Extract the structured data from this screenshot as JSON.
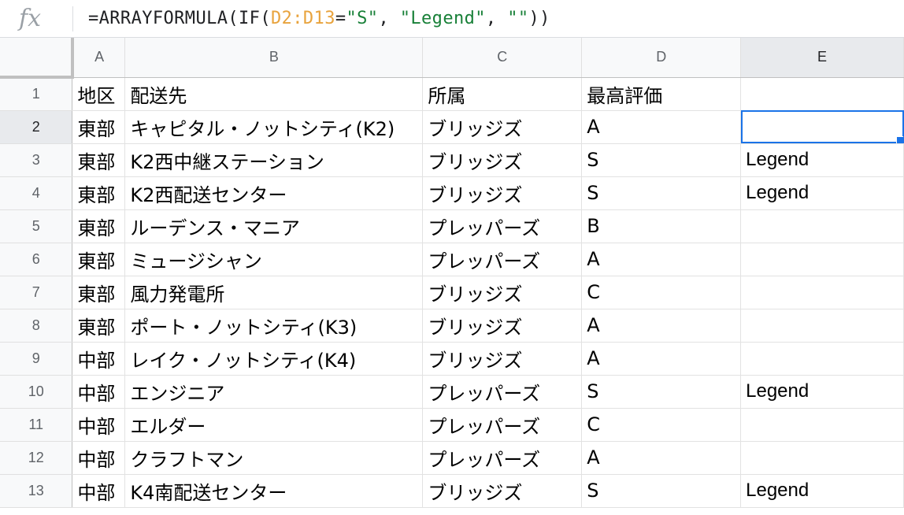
{
  "formula_bar": {
    "icon": "fx",
    "tokens": [
      "=ARRAYFORMULA(IF(",
      "D2:D13",
      "=",
      "\"S\"",
      ", ",
      "\"Legend\"",
      ", ",
      "\"\"",
      "))"
    ]
  },
  "columns": [
    "A",
    "B",
    "C",
    "D",
    "E"
  ],
  "colors": {
    "selection": "#1a73e8",
    "range_token": "#e8a33d",
    "string_token": "#188038"
  },
  "rows": [
    {
      "num": "1",
      "a": "地区",
      "b": "配送先",
      "c": "所属",
      "d": "最高評価",
      "e": ""
    },
    {
      "num": "2",
      "a": "東部",
      "b": "キャピタル・ノットシティ(K2)",
      "c": "ブリッジズ",
      "d": "A",
      "e": ""
    },
    {
      "num": "3",
      "a": "東部",
      "b": "K2西中継ステーション",
      "c": "ブリッジズ",
      "d": "S",
      "e": "Legend"
    },
    {
      "num": "4",
      "a": "東部",
      "b": "K2西配送センター",
      "c": "ブリッジズ",
      "d": "S",
      "e": "Legend"
    },
    {
      "num": "5",
      "a": "東部",
      "b": "ルーデンス・マニア",
      "c": "プレッパーズ",
      "d": "B",
      "e": ""
    },
    {
      "num": "6",
      "a": "東部",
      "b": "ミュージシャン",
      "c": "プレッパーズ",
      "d": "A",
      "e": ""
    },
    {
      "num": "7",
      "a": "東部",
      "b": "風力発電所",
      "c": "ブリッジズ",
      "d": "C",
      "e": ""
    },
    {
      "num": "8",
      "a": "東部",
      "b": "ポート・ノットシティ(K3)",
      "c": "ブリッジズ",
      "d": "A",
      "e": ""
    },
    {
      "num": "9",
      "a": "中部",
      "b": "レイク・ノットシティ(K4)",
      "c": "ブリッジズ",
      "d": "A",
      "e": ""
    },
    {
      "num": "10",
      "a": "中部",
      "b": "エンジニア",
      "c": "プレッパーズ",
      "d": "S",
      "e": "Legend"
    },
    {
      "num": "11",
      "a": "中部",
      "b": "エルダー",
      "c": "プレッパーズ",
      "d": "C",
      "e": ""
    },
    {
      "num": "12",
      "a": "中部",
      "b": "クラフトマン",
      "c": "プレッパーズ",
      "d": "A",
      "e": ""
    },
    {
      "num": "13",
      "a": "中部",
      "b": "K4南配送センター",
      "c": "ブリッジズ",
      "d": "S",
      "e": "Legend"
    }
  ]
}
